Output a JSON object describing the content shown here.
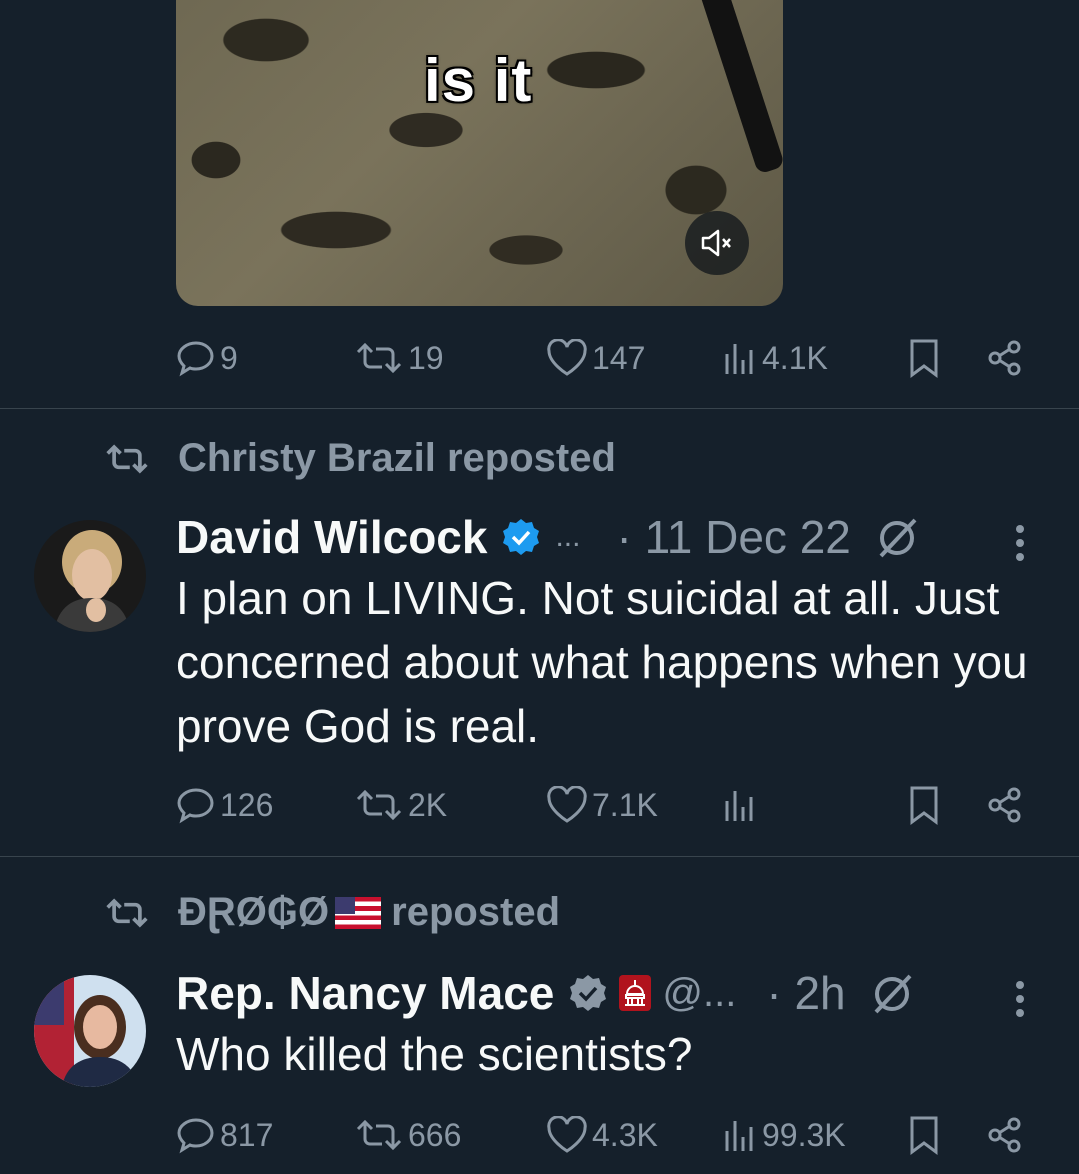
{
  "video": {
    "caption": "is it"
  },
  "tweets": [
    {
      "actions": {
        "replies": "9",
        "reposts": "19",
        "likes": "147",
        "views": "4.1K"
      }
    },
    {
      "repost_by": "Christy Brazil reposted",
      "author": "David Wilcock",
      "handle": "...",
      "time": "· 11 Dec 22",
      "text": "I plan on LIVING. Not suicidal at all. Just concerned about what happens when you prove God is real.",
      "actions": {
        "replies": "126",
        "reposts": "2K",
        "likes": "7.1K",
        "views": ""
      }
    },
    {
      "repost_by_name": "ĐⱤØ₲Ø",
      "repost_suffix": "reposted",
      "author": "Rep. Nancy Mace",
      "handle": "@...",
      "time": "· 2h",
      "text": "Who killed the scientists?",
      "actions": {
        "replies": "817",
        "reposts": "666",
        "likes": "4.3K",
        "views": "99.3K"
      }
    }
  ],
  "colors": {
    "background": "#15202b",
    "muted": "#8b98a5",
    "verified": "#1d9bf0",
    "divider": "#38444d"
  }
}
